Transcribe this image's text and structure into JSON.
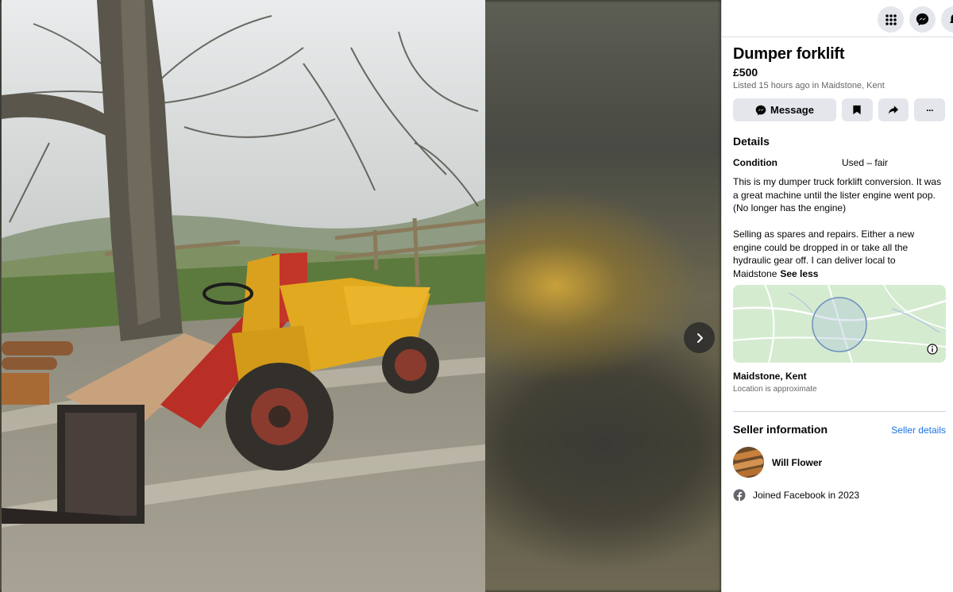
{
  "listing": {
    "title": "Dumper forklift",
    "price": "£500",
    "listed": "Listed 15 hours ago in Maidstone, Kent"
  },
  "actions": {
    "message_label": "Message",
    "save_icon": "bookmark-icon",
    "share_icon": "share-icon",
    "more_label": "···"
  },
  "details": {
    "heading": "Details",
    "condition_label": "Condition",
    "condition_value": "Used – fair",
    "description": "This is my dumper truck forklift conversion.  It was a great machine until the lister engine went pop.  (No longer has the engine)\n\nSelling as spares and repairs.    Either a new engine could be dropped in or take all the hydraulic gear off.    I can deliver local to Maidstone",
    "see_less": "See less"
  },
  "location": {
    "name": "Maidstone, Kent",
    "note": "Location is approximate"
  },
  "seller": {
    "heading": "Seller information",
    "details_link": "Seller details",
    "name": "Will Flower",
    "joined": "Joined Facebook in 2023"
  },
  "colors": {
    "accent": "#1b74e4",
    "button_bg": "#e4e6eb",
    "map_bg": "#d8ecd4"
  }
}
